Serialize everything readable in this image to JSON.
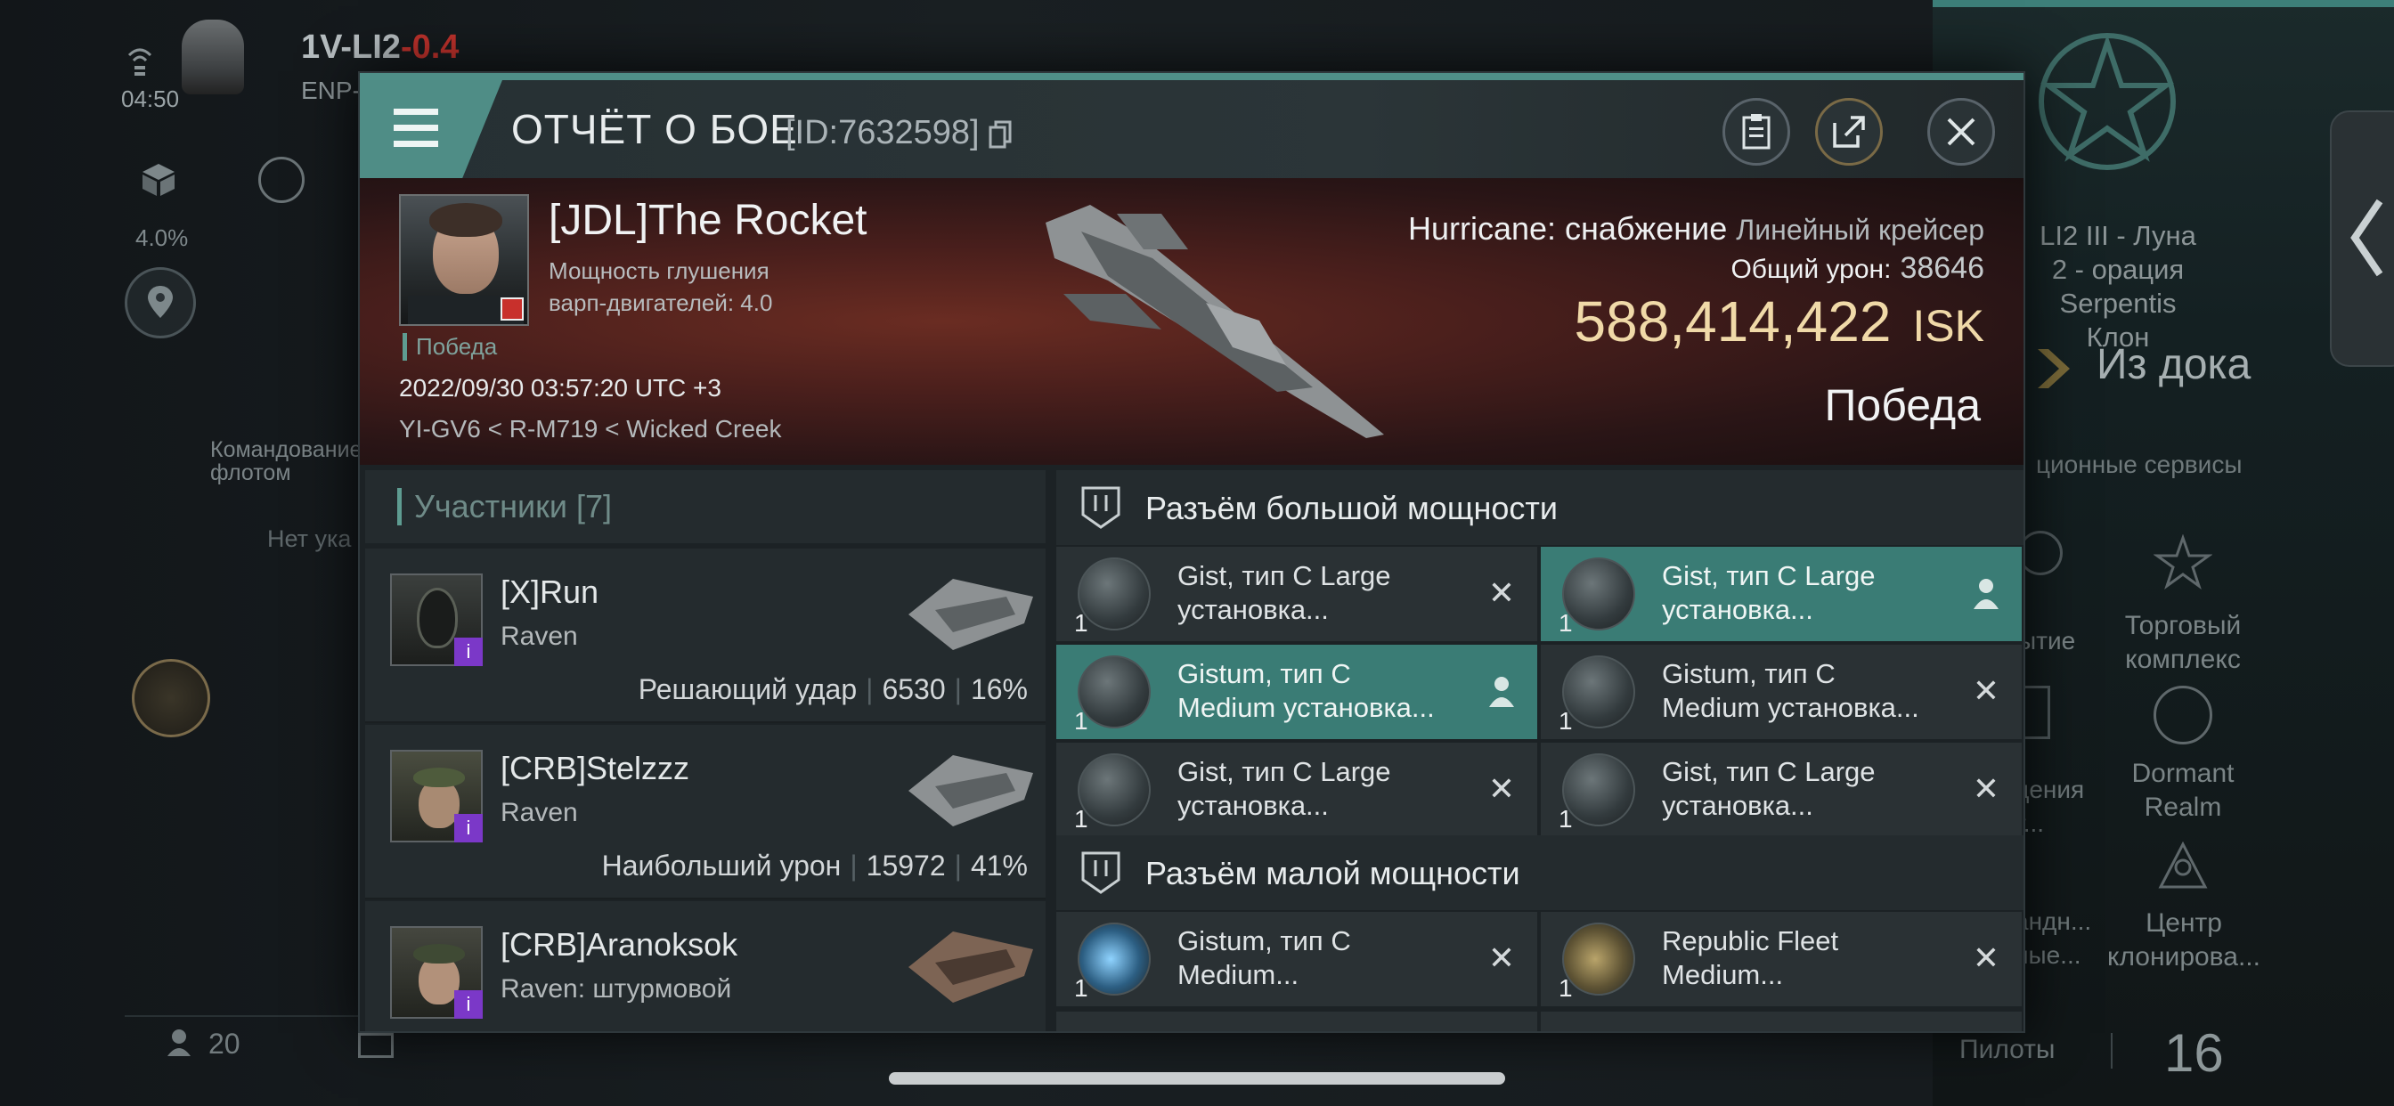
{
  "hud": {
    "system_name": "1V-LI2",
    "security": "-0.4",
    "region_prefix": "ENP-",
    "time": "04:50",
    "cargo_percent": "4.0%",
    "fleet_command": "Командование флотом",
    "fleet_status": "Нет ука",
    "online_count": "20",
    "location_title": "LI2 III - Луна 2 - орация Serpentis Клон",
    "undock": "Из дока",
    "station_services": "ционные сервисы",
    "service_items": [
      "ытие",
      "Торговый комплекс",
      "дения т...",
      "Dormant Realm",
      "андн... ные...",
      "Центр клонирова..."
    ],
    "pilots_label": "Пилоты",
    "pilots_count": "16"
  },
  "report": {
    "title": "ОТЧЁТ О БОЕ",
    "report_id": "[ID:7632598]",
    "pilot_name": "[JDL]The Rocket",
    "jam_label": "Мощность глушения варп-двигателей: 4.0",
    "victory_tag": "Победа",
    "datetime": "2022/09/30 03:57:20 UTC +3",
    "location": "YI-GV6 < R-M719 < Wicked Creek",
    "ship_name": "Hurricane: снабжение",
    "ship_class": "Линейный крейсер",
    "total_damage_label": "Общий урон:",
    "total_damage": "38646",
    "isk_value": "588,414,422",
    "isk_unit": "ISK",
    "result": "Победа"
  },
  "participants": {
    "title": "Участники [7]",
    "rows": [
      {
        "name": "[X]Run",
        "ship": "Raven",
        "role": "Решающий удар",
        "damage": "6530",
        "percent": "16%"
      },
      {
        "name": "[CRB]Stelzzz",
        "ship": "Raven",
        "role": "Наибольший урон",
        "damage": "15972",
        "percent": "41%"
      },
      {
        "name": "[CRB]Aranoksok",
        "ship": "Raven: штурмовой",
        "role": "",
        "damage": "",
        "percent": ""
      }
    ]
  },
  "modules": {
    "high_title": "Разъём большой мощности",
    "low_title": "Разъём малой мощности",
    "high": [
      {
        "qty": "1",
        "name1": "Gist, тип C Large",
        "name2": "установка...",
        "state": "destroyed"
      },
      {
        "qty": "1",
        "name1": "Gist, тип C Large",
        "name2": "установка...",
        "state": "dropped"
      },
      {
        "qty": "1",
        "name1": "Gistum, тип C",
        "name2": "Medium установка...",
        "state": "dropped"
      },
      {
        "qty": "1",
        "name1": "Gistum, тип C",
        "name2": "Medium установка...",
        "state": "destroyed"
      },
      {
        "qty": "1",
        "name1": "Gist, тип C Large",
        "name2": "установка...",
        "state": "destroyed"
      },
      {
        "qty": "1",
        "name1": "Gist, тип C Large",
        "name2": "установка...",
        "state": "destroyed"
      }
    ],
    "low": [
      {
        "qty": "1",
        "name1": "Gistum, тип C",
        "name2": "Medium...",
        "state": "destroyed"
      },
      {
        "qty": "1",
        "name1": "Republic Fleet",
        "name2": "Medium...",
        "state": "destroyed"
      }
    ]
  }
}
